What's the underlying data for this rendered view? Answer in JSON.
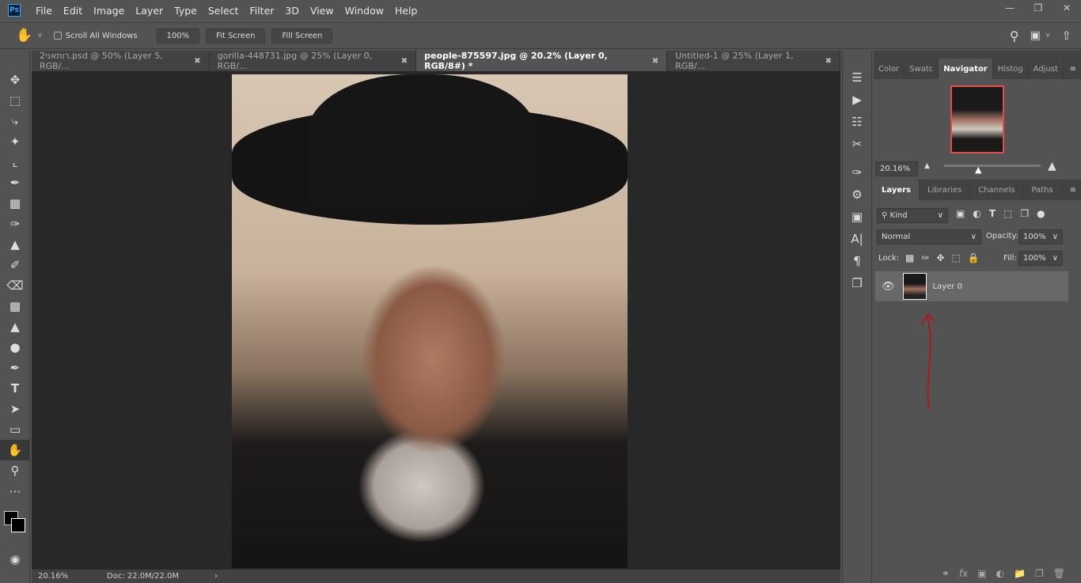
{
  "menubar": {
    "logo": "Ps",
    "items": [
      "File",
      "Edit",
      "Image",
      "Layer",
      "Type",
      "Select",
      "Filter",
      "3D",
      "View",
      "Window",
      "Help"
    ],
    "window_controls": [
      "minimize",
      "restore",
      "close"
    ]
  },
  "options": {
    "scroll_all_windows": "Scroll All Windows",
    "zoom_100": "100%",
    "fit_screen": "Fit Screen",
    "fill_screen": "Fill Screen"
  },
  "tabs": [
    {
      "label": "2רותאני.psd @ 50% (Layer 5, RGB/...",
      "active": false
    },
    {
      "label": "gorilla-448731.jpg @ 25% (Layer 0, RGB/...",
      "active": false
    },
    {
      "label": "people-875597.jpg @ 20.2% (Layer 0, RGB/8#) *",
      "active": true
    },
    {
      "label": "Untitled-1 @ 25% (Layer 1, RGB/...",
      "active": false
    }
  ],
  "status": {
    "zoom": "20.16%",
    "doc": "Doc: 22.0M/22.0M"
  },
  "top_panel": {
    "tabs": [
      "Color",
      "Swatc",
      "Navigator",
      "Histog",
      "Adjust"
    ],
    "active": "Navigator",
    "zoom": "20.16%"
  },
  "layers_panel": {
    "tabs": [
      "Layers",
      "Libraries",
      "Channels",
      "Paths"
    ],
    "active": "Layers",
    "filter": "Kind",
    "blend_mode": "Normal",
    "opacity_label": "Opacity:",
    "opacity": "100%",
    "lock_label": "Lock:",
    "fill_label": "Fill:",
    "fill": "100%",
    "layers": [
      {
        "name": "Layer 0",
        "visible": true
      }
    ]
  },
  "colors": {
    "accent_navigator_frame": "#e84a4a",
    "annotation_arrow": "#b01818"
  }
}
